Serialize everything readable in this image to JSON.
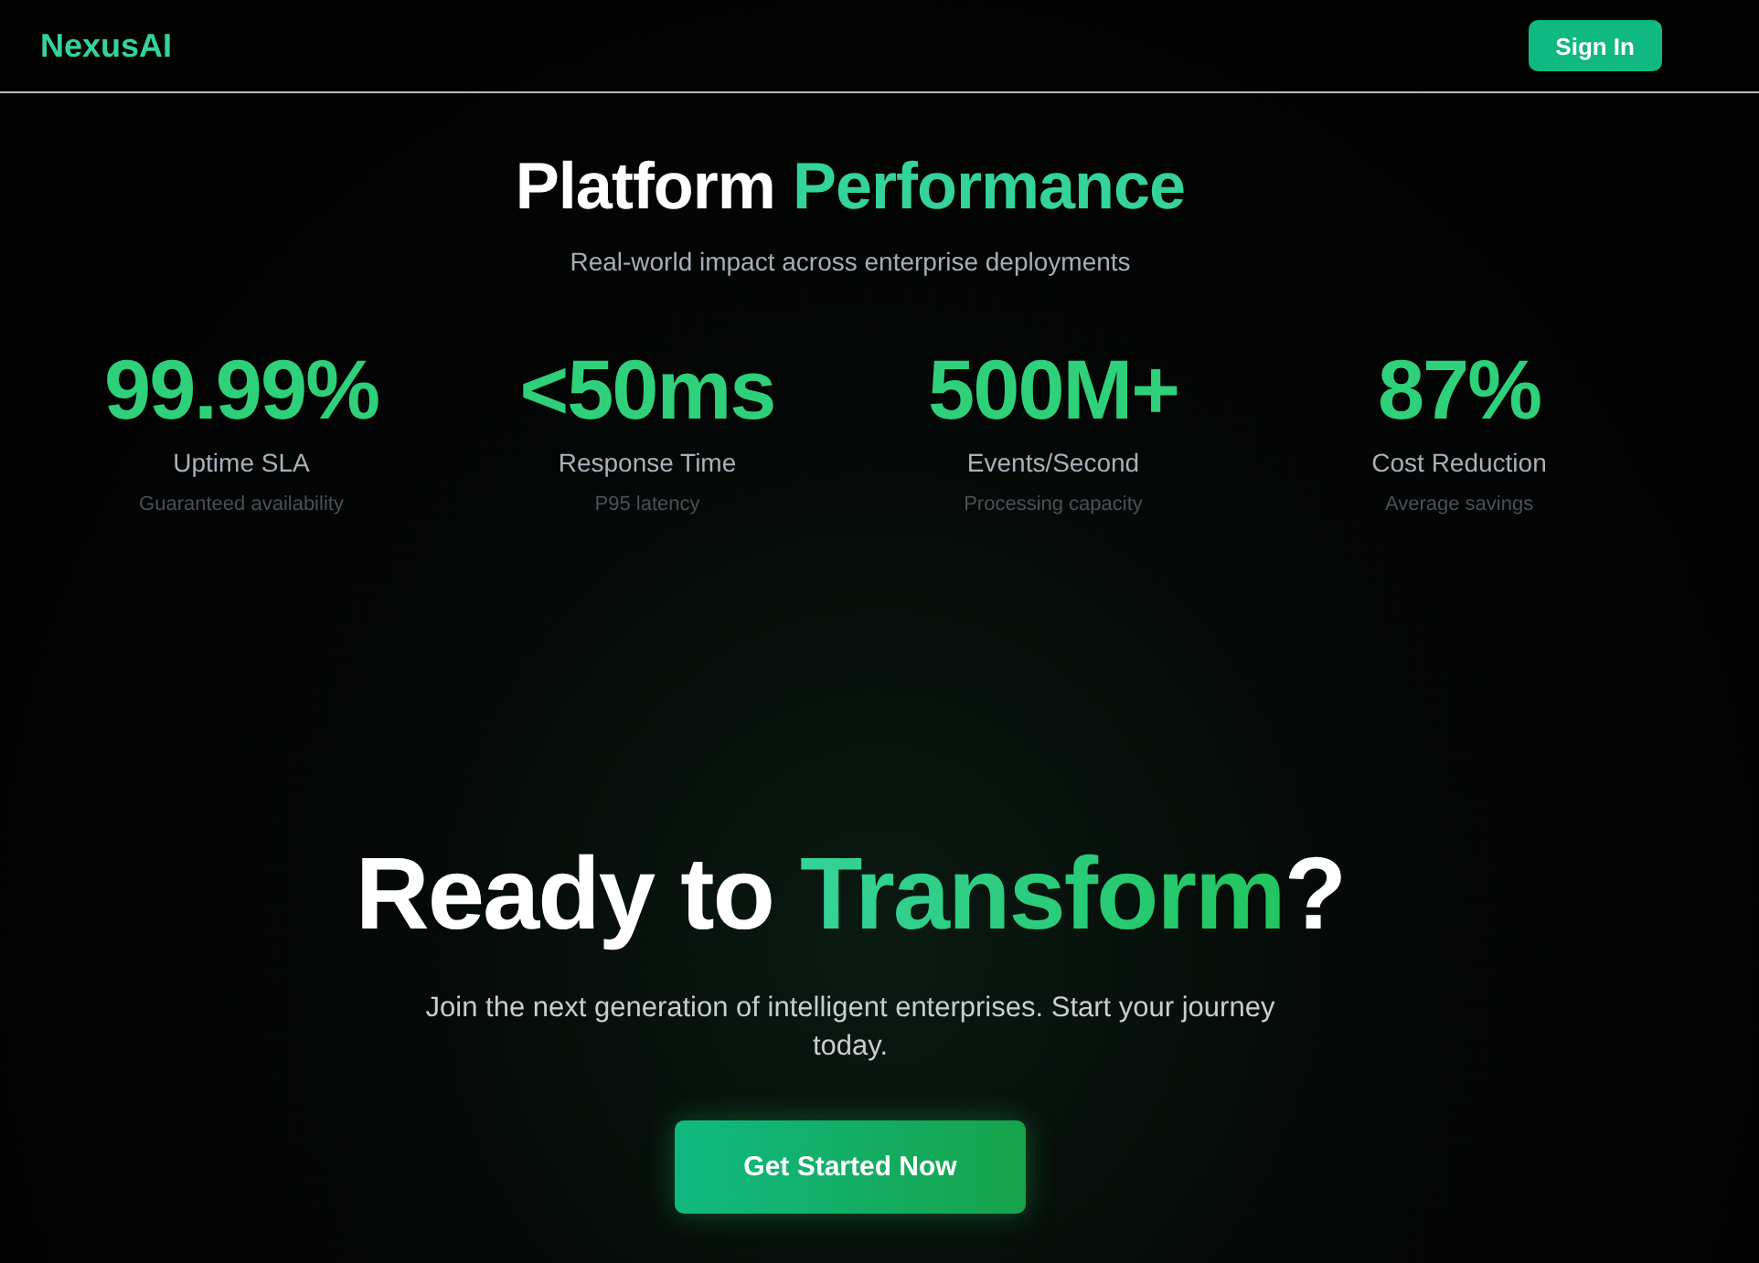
{
  "header": {
    "logo": "NexusAI",
    "sign_in": "Sign In"
  },
  "performance": {
    "title": [
      "Platform ",
      "Performance"
    ],
    "subtitle": "Real-world impact across enterprise deployments",
    "stats": [
      {
        "value": "99.99%",
        "label": "Uptime SLA",
        "note": "Guaranteed availability"
      },
      {
        "value": "<50ms",
        "label": "Response Time",
        "note": "P95 latency"
      },
      {
        "value": "500M+",
        "label": "Events/Second",
        "note": "Processing capacity"
      },
      {
        "value": "87%",
        "label": "Cost Reduction",
        "note": "Average savings"
      }
    ]
  },
  "cta": {
    "title": [
      "Ready to ",
      "Transform",
      "?"
    ],
    "text": "Join the next generation of intelligent enterprises. Start your journey today.",
    "button": "Get Started Now"
  }
}
